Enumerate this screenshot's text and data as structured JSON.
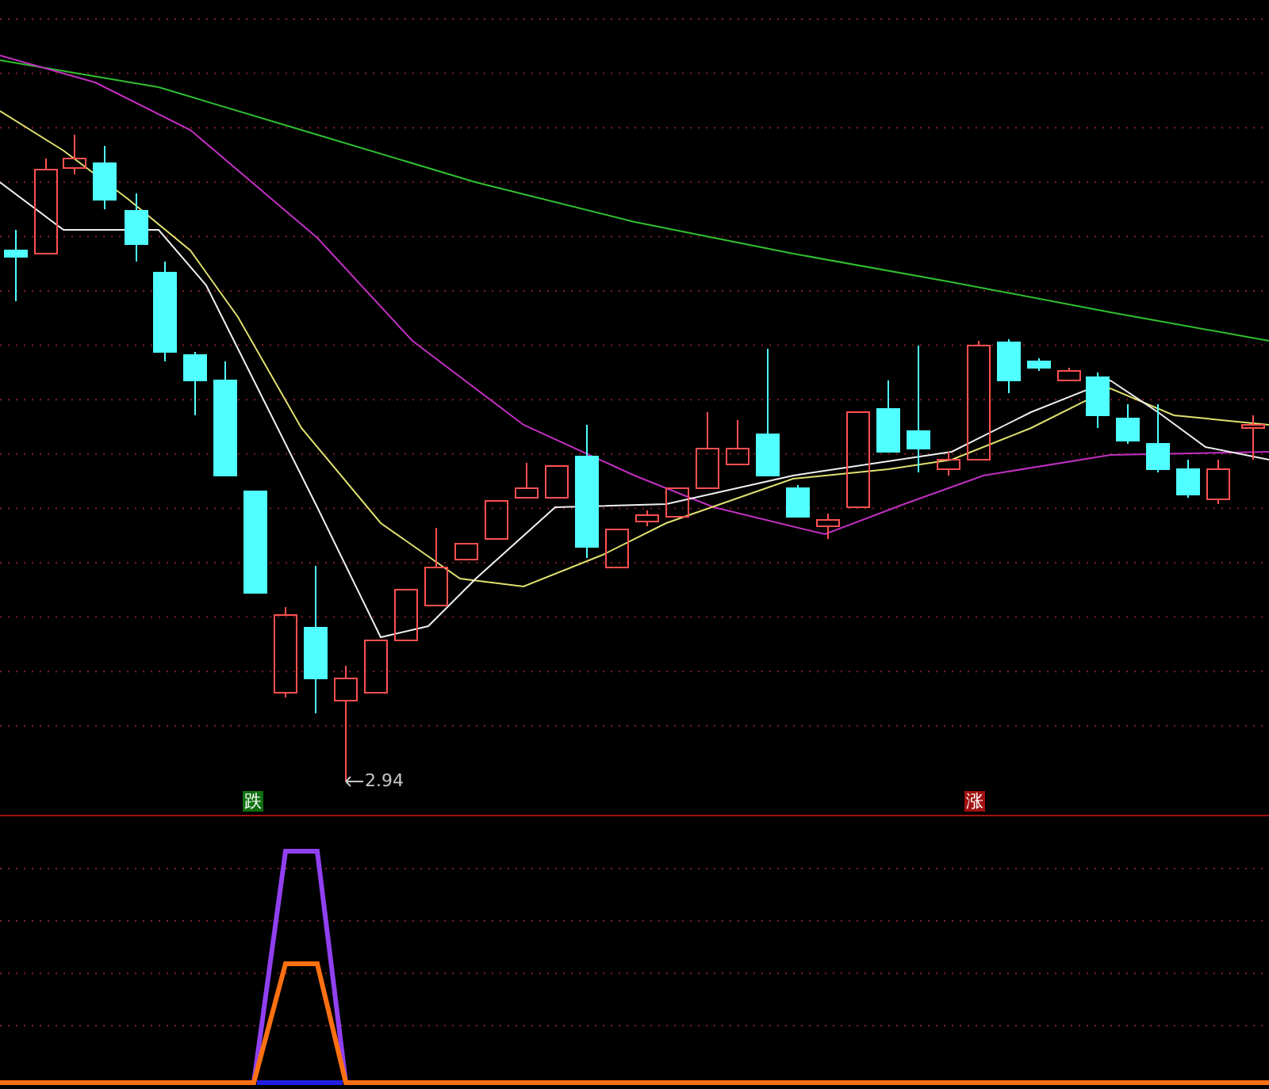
{
  "price_chart": {
    "low_label": "2.94"
  },
  "signals": [
    {
      "label": "跌",
      "kind": "down"
    },
    {
      "label": "涨",
      "kind": "up"
    }
  ]
}
